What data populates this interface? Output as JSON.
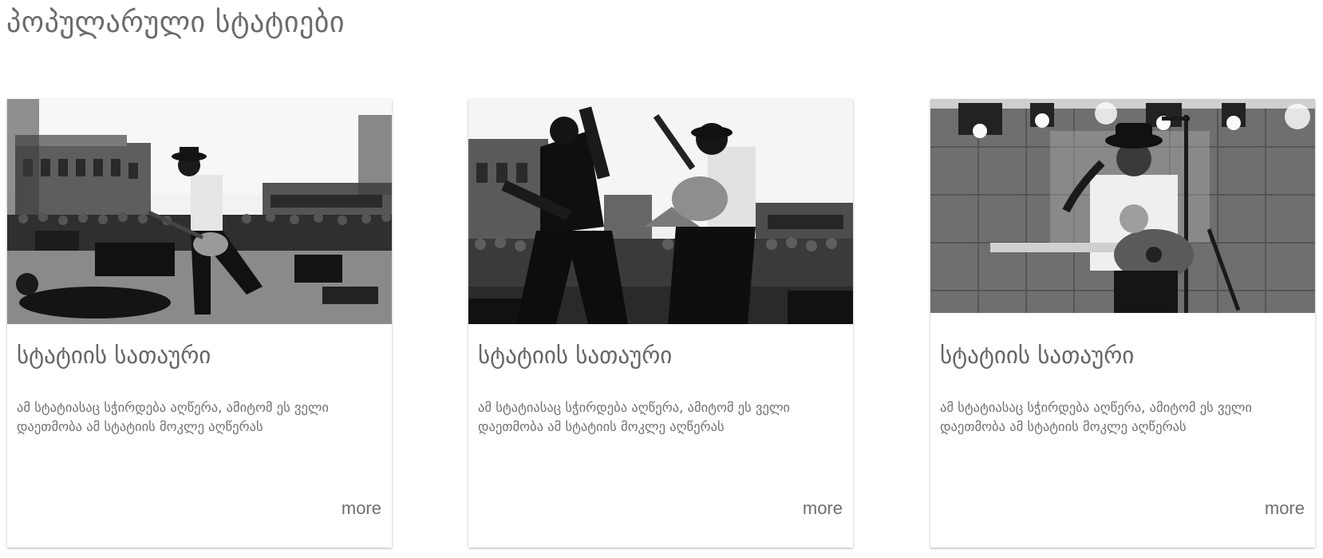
{
  "section": {
    "title": "პოპულარული სტატიები"
  },
  "cards": [
    {
      "image": "concert-photo-street-stage",
      "title": "სტატიის სათაური",
      "description": "ამ სტატიასაც სჭირდება აღწერა, ამიტომ ეს ველი დაეთმობა ამ სტატიის მოკლე აღწერას",
      "more_label": "more"
    },
    {
      "image": "concert-photo-two-guitarists",
      "title": "სტატიის სათაური",
      "description": "ამ სტატიასაც სჭირდება აღწერა, ამიტომ ეს ველი დაეთმობა ამ სტატიის მოკლე აღწერას",
      "more_label": "more"
    },
    {
      "image": "concert-photo-guitarist-stage-lights",
      "title": "სტატიის სათაური",
      "description": "ამ სტატიასაც სჭირდება აღწერა, ამიტომ ეს ველი დაეთმობა ამ სტატიის მოკლე აღწერას",
      "more_label": "more"
    }
  ]
}
